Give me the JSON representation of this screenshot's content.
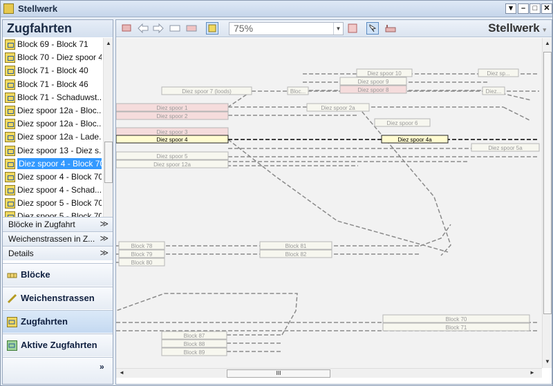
{
  "window": {
    "title": "Stellwerk"
  },
  "left": {
    "header": "Zugfahrten",
    "items": [
      "Block 69 - Block 71",
      "Block 70 - Diez spoor 4",
      "Block 71 - Block 40",
      "Block 71 - Block 46",
      "Block 71 - Schaduwst...",
      "Diez spoor 12a - Bloc...",
      "Diez spoor 12a - Bloc...",
      "Diez spoor 12a - Lade...",
      "Diez spoor 13 - Diez s...",
      "Diez spoor 4 - Block 70",
      "Diez spoor 4 - Block 70",
      "Diez spoor 4 - Schad...",
      "Diez spoor 5 - Block 70",
      "Diez spoor 5 - Block 70"
    ],
    "selected_index": 9,
    "sections": [
      "Blöcke in Zugfahrt",
      "Weichenstrassen in Z...",
      "Details"
    ],
    "nav": [
      "Blöcke",
      "Weichenstrassen",
      "Zugfahrten",
      "Aktive Zugfahrten"
    ]
  },
  "toolbar": {
    "zoom": "75%",
    "title": "Stellwerk"
  },
  "blocks": [
    "Diez spoor 10",
    "Diez sp...",
    "Diez spoor 9",
    "Diez spoor 8",
    "Diez spoor 7 (loods)",
    "Bloc...",
    "Diez...",
    "Diez spoor 1",
    "Diez spoor 2",
    "Diez spoor 2a",
    "Diez spoor 6",
    "Diez spoor 3",
    "Diez spoor 4",
    "Diez spoor 4a",
    "Diez spoor 5",
    "Diez spoor 5a",
    "Diez spoor 12a",
    "Block 78",
    "Block 79",
    "Block 80",
    "Block 81",
    "Block 82",
    "Block 70",
    "Block 71",
    "Block 87",
    "Block 88",
    "Block 89"
  ],
  "colors": {
    "selection": "#3399ff",
    "active_block": "#fffbd0",
    "occupied_block": "#f5dcdc",
    "track": "#7a7a7a"
  }
}
